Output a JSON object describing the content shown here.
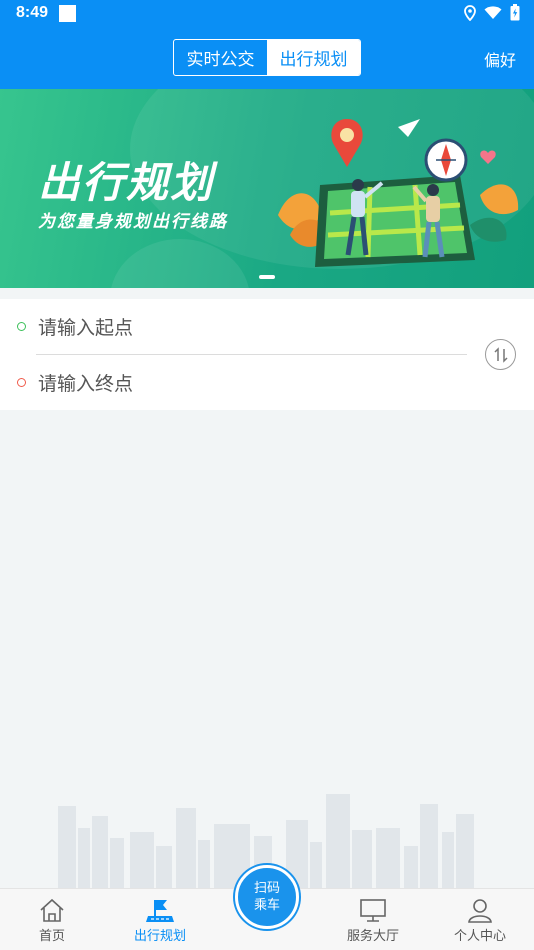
{
  "status_bar": {
    "time": "8:49"
  },
  "header": {
    "tabs": [
      {
        "label": "实时公交",
        "active": false
      },
      {
        "label": "出行规划",
        "active": true
      }
    ],
    "preferences_label": "偏好"
  },
  "banner": {
    "title": "出行规划",
    "subtitle": "为您量身规划出行线路",
    "slide_count": 1,
    "active_slide": 1
  },
  "route": {
    "start_placeholder": "请输入起点",
    "end_placeholder": "请输入终点",
    "swap_icon": "swap-vertical-icon"
  },
  "bottom_nav": {
    "items": [
      {
        "label": "首页",
        "icon": "home-icon",
        "active": false
      },
      {
        "label": "出行规划",
        "icon": "flag-icon",
        "active": true
      },
      {
        "label": "服务大厅",
        "icon": "monitor-icon",
        "active": false
      },
      {
        "label": "个人中心",
        "icon": "person-icon",
        "active": false
      }
    ],
    "scan_button": {
      "line1": "扫码",
      "line2": "乘车"
    }
  },
  "colors": {
    "primary": "#0a8ff5",
    "start_dot": "#3cc05a",
    "end_dot": "#f05a4a",
    "banner_green": "#1aa884"
  }
}
